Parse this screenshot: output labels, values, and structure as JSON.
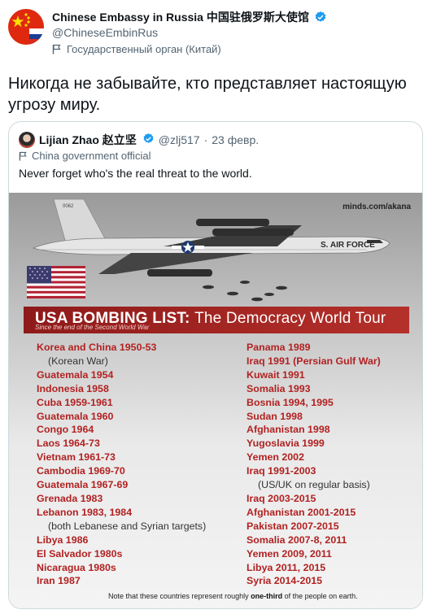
{
  "tweet": {
    "author_name": "Chinese Embassy in Russia 中国驻俄罗斯大使馆",
    "author_handle": "@ChineseEmbinRus",
    "account_label": "Государственный орган (Китай)",
    "text": "Никогда не забывайте, кто представляет настоящую угрозу миру."
  },
  "quote": {
    "author_name": "Lijian Zhao 赵立坚",
    "author_handle": "@zlj517",
    "date": "23 февр.",
    "account_label": "China government official",
    "text": "Never forget who's the real threat to the world.",
    "image": {
      "watermark": "minds.com/akana",
      "tail_number": "0062",
      "fuselage_text": "S. AIR FORCE",
      "title_bold": "USA BOMBING LIST:",
      "title_rest": "The Democracy World Tour",
      "subtitle": "Since the end of the Second World War",
      "left_list": [
        {
          "text": "Korea and China 1950-53",
          "note": false
        },
        {
          "text": "(Korean War)",
          "note": true
        },
        {
          "text": "Guatemala 1954",
          "note": false
        },
        {
          "text": "Indonesia 1958",
          "note": false
        },
        {
          "text": "Cuba 1959-1961",
          "note": false
        },
        {
          "text": "Guatemala 1960",
          "note": false
        },
        {
          "text": "Congo 1964",
          "note": false
        },
        {
          "text": "Laos 1964-73",
          "note": false
        },
        {
          "text": "Vietnam 1961-73",
          "note": false
        },
        {
          "text": "Cambodia 1969-70",
          "note": false
        },
        {
          "text": "Guatemala 1967-69",
          "note": false
        },
        {
          "text": "Grenada 1983",
          "note": false
        },
        {
          "text": "Lebanon 1983, 1984",
          "note": false
        },
        {
          "text": "(both Lebanese and Syrian targets)",
          "note": true
        },
        {
          "text": "Libya 1986",
          "note": false
        },
        {
          "text": "El Salvador 1980s",
          "note": false
        },
        {
          "text": "Nicaragua 1980s",
          "note": false
        },
        {
          "text": "Iran 1987",
          "note": false
        }
      ],
      "right_list": [
        {
          "text": "Panama 1989",
          "note": false
        },
        {
          "text": "Iraq 1991 (Persian Gulf War)",
          "note": false
        },
        {
          "text": "Kuwait 1991",
          "note": false
        },
        {
          "text": "Somalia 1993",
          "note": false
        },
        {
          "text": "Bosnia 1994, 1995",
          "note": false
        },
        {
          "text": "Sudan 1998",
          "note": false
        },
        {
          "text": "Afghanistan 1998",
          "note": false
        },
        {
          "text": "Yugoslavia 1999",
          "note": false
        },
        {
          "text": "Yemen 2002",
          "note": false
        },
        {
          "text": "Iraq 1991-2003",
          "note": false
        },
        {
          "text": "(US/UK on regular basis)",
          "note": true
        },
        {
          "text": "Iraq 2003-2015",
          "note": false
        },
        {
          "text": "Afghanistan 2001-2015",
          "note": false
        },
        {
          "text": "Pakistan 2007-2015",
          "note": false
        },
        {
          "text": "Somalia 2007-8, 2011",
          "note": false
        },
        {
          "text": "Yemen 2009, 2011",
          "note": false
        },
        {
          "text": "Libya 2011, 2015",
          "note": false
        },
        {
          "text": "Syria 2014-2015",
          "note": false
        }
      ],
      "footnote_pre": "Note that these countries represent roughly ",
      "footnote_bold": "one-third",
      "footnote_post": " of the people on earth."
    }
  },
  "colors": {
    "verified": "#1d9bf0",
    "banner_red": "#b5302a",
    "list_red": "#b22222"
  },
  "icons": [
    "verified-badge-icon",
    "flag-icon",
    "china-flag-avatar",
    "us-flag-image",
    "bomber-plane-image"
  ]
}
